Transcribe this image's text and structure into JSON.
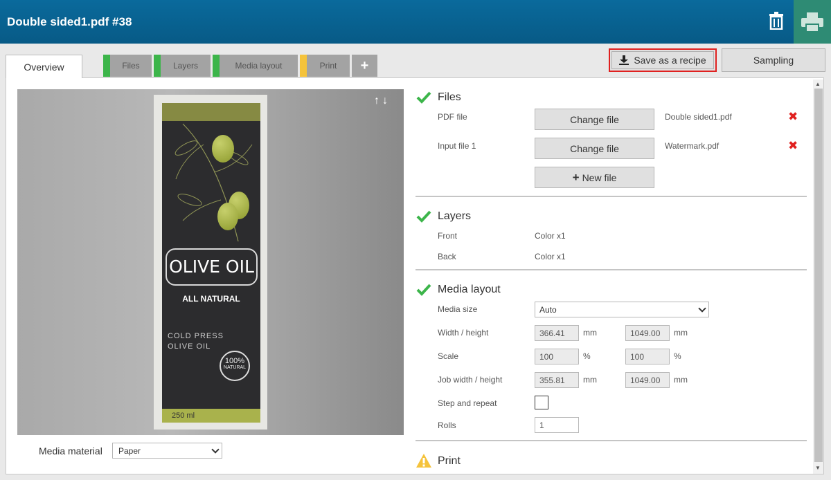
{
  "header": {
    "title": "Double sided1.pdf #38"
  },
  "tabs": [
    {
      "label": "Overview"
    },
    {
      "label": "Files",
      "color": "#3cb54a"
    },
    {
      "label": "Layers",
      "color": "#3cb54a"
    },
    {
      "label": "Media layout",
      "color": "#3cb54a"
    },
    {
      "label": "Print",
      "color": "#f5c33b"
    },
    {
      "label": "+"
    }
  ],
  "actions": {
    "save_recipe": "Save as a recipe",
    "sampling": "Sampling"
  },
  "preview": {
    "label_title": "OLIVE OIL",
    "label_sub": "ALL NATURAL",
    "cold_press_1": "COLD PRESS",
    "cold_press_2": "OLIVE OIL",
    "badge_1": "100%",
    "badge_2": "NATURAL",
    "volume": "250 ml"
  },
  "media_material": {
    "label": "Media material",
    "value": "Paper"
  },
  "files": {
    "title": "Files",
    "rows": [
      {
        "label": "PDF file",
        "button": "Change file",
        "file": "Double sided1.pdf"
      },
      {
        "label": "Input file 1",
        "button": "Change file",
        "file": "Watermark.pdf"
      }
    ],
    "new_file": "New file"
  },
  "layers": {
    "title": "Layers",
    "rows": [
      {
        "label": "Front",
        "value": "Color x1"
      },
      {
        "label": "Back",
        "value": "Color x1"
      }
    ]
  },
  "media_layout": {
    "title": "Media layout",
    "media_size_label": "Media size",
    "media_size": "Auto",
    "wh_label": "Width / height",
    "width": "366.41",
    "height": "1049.00",
    "scale_label": "Scale",
    "scale_w": "100",
    "scale_h": "100",
    "job_label": "Job width / height",
    "job_w": "355.81",
    "job_h": "1049.00",
    "step_label": "Step and repeat",
    "rolls_label": "Rolls",
    "rolls": "1",
    "unit_mm": "mm",
    "unit_pct": "%"
  },
  "print": {
    "title": "Print"
  }
}
